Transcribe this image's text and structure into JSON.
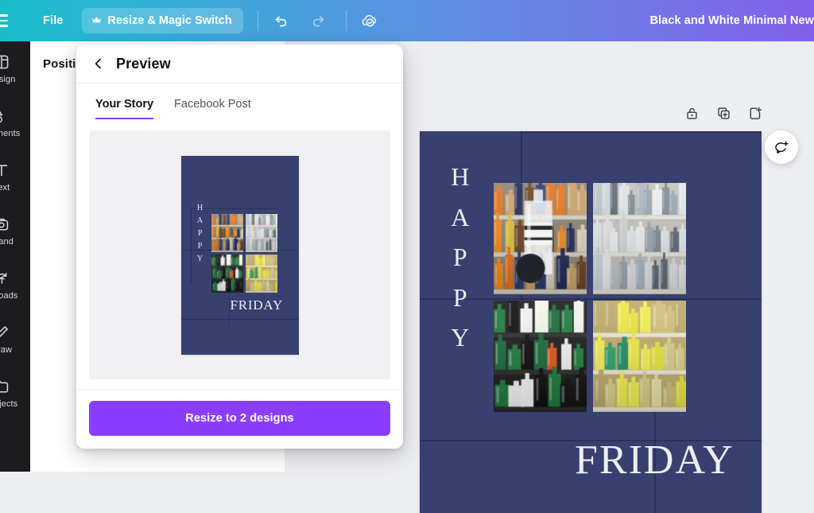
{
  "topbar": {
    "menu_icon": "hamburger-icon",
    "file_label": "File",
    "resize_label": "Resize & Magic Switch",
    "resize_badge_icon": "crown-icon",
    "undo_icon": "undo-icon",
    "redo_icon": "redo-icon",
    "saved_icon": "cloud-check-icon",
    "doc_title": "Black and White Minimal New",
    "gradient_from": "#18bdc9",
    "gradient_to": "#8161ea"
  },
  "rail": {
    "items": [
      {
        "label": "Design",
        "icon": "design-icon"
      },
      {
        "label": "Elements",
        "icon": "elements-icon"
      },
      {
        "label": "Text",
        "icon": "text-icon"
      },
      {
        "label": "Brand",
        "icon": "brand-icon"
      },
      {
        "label": "Uploads",
        "icon": "uploads-icon"
      },
      {
        "label": "Draw",
        "icon": "draw-icon"
      },
      {
        "label": "Projects",
        "icon": "projects-icon"
      }
    ]
  },
  "side_panel": {
    "title": "Position"
  },
  "page_tools": {
    "lock_icon": "unlocked-padlock-icon",
    "duplicate_icon": "duplicate-page-icon",
    "add_page_icon": "add-page-icon",
    "comment_icon": "add-comment-icon"
  },
  "modal": {
    "back_icon": "chevron-left-icon",
    "title": "Preview",
    "tabs": [
      {
        "label": "Your Story",
        "active": true
      },
      {
        "label": "Facebook Post",
        "active": false
      }
    ],
    "active_tab_color": "#8b3dff",
    "primary_button": "Resize to 2 designs",
    "primary_button_color": "#8b3dff"
  },
  "design": {
    "background_color": "#384070",
    "heading_vertical": "HAPPY",
    "heading_vertical_letters": [
      "H",
      "A",
      "P",
      "P",
      "Y"
    ],
    "heading_horizontal": "FRIDAY",
    "text_color": "#eceef6",
    "photo_count": 4,
    "photos": [
      {
        "name": "liquor-shelf-bottle-in-hand"
      },
      {
        "name": "liquor-shelf-clear-bottles"
      },
      {
        "name": "dark-bottles-display-case"
      },
      {
        "name": "yellow-cap-bottles-shelf"
      }
    ]
  }
}
